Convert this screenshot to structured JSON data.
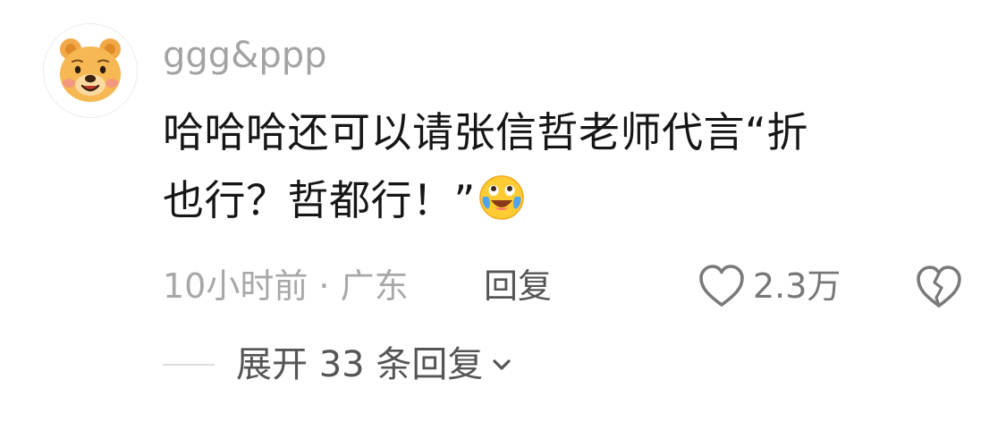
{
  "comment": {
    "username": "ggg&ppp",
    "avatar_icon": "winnie-the-pooh-avatar",
    "content_line1": "哈哈哈还可以请张信哲老师代言“折",
    "content_line2": "也行？哲都行！”",
    "emoji": "crying-laughing-emoji",
    "meta": "10小时前 · 广东",
    "reply_label": "回复",
    "like_icon": "heart-outline-icon",
    "like_count": "2.3万",
    "dislike_icon": "broken-heart-icon",
    "expand_label": "展开 33 条回复",
    "expand_icon": "chevron-down-icon"
  },
  "colors": {
    "text": "#161616",
    "muted": "#a8a8a8",
    "action": "#555555",
    "avatar_bg": "#f5b14f"
  }
}
